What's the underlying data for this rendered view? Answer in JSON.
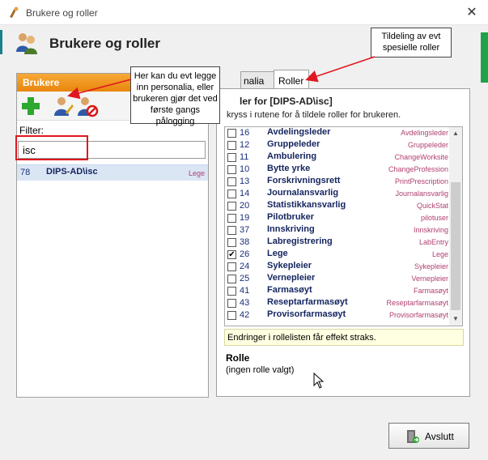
{
  "window": {
    "title": "Brukere og roller",
    "close_glyph": "✕"
  },
  "header": {
    "title": "Brukere og roller",
    "icon": "users-icon"
  },
  "left_panel": {
    "section_title": "Brukere",
    "filter_label": "Filter:",
    "filter_value": "isc",
    "users": [
      {
        "id": "78",
        "name": "DIPS-AD\\isc",
        "role": "Lege"
      }
    ]
  },
  "right_panel": {
    "tabs": [
      {
        "label": "nalia",
        "active": false
      },
      {
        "label": "Roller",
        "active": true
      }
    ],
    "heading": "ler for [DIPS-AD\\isc]",
    "subheading": "kryss i rutene for å tildele roller for brukeren.",
    "roles": [
      {
        "id": "16",
        "name": "Avdelingsleder",
        "code": "Avdelingsleder",
        "checked": false
      },
      {
        "id": "12",
        "name": "Gruppeleder",
        "code": "Gruppeleder",
        "checked": false
      },
      {
        "id": "11",
        "name": "Ambulering",
        "code": "ChangeWorksite",
        "checked": false
      },
      {
        "id": "10",
        "name": "Bytte yrke",
        "code": "ChangeProfession",
        "checked": false
      },
      {
        "id": "13",
        "name": "Forskrivningsrett",
        "code": "PrintPrescription",
        "checked": false
      },
      {
        "id": "14",
        "name": "Journalansvarlig",
        "code": "Journalansvarlig",
        "checked": false
      },
      {
        "id": "20",
        "name": "Statistikkansvarlig",
        "code": "QuickStat",
        "checked": false
      },
      {
        "id": "19",
        "name": "Pilotbruker",
        "code": "pilotuser",
        "checked": false
      },
      {
        "id": "37",
        "name": "Innskriving",
        "code": "Innskriving",
        "checked": false
      },
      {
        "id": "38",
        "name": "Labregistrering",
        "code": "LabEntry",
        "checked": false
      },
      {
        "id": "26",
        "name": "Lege",
        "code": "Lege",
        "checked": true
      },
      {
        "id": "24",
        "name": "Sykepleier",
        "code": "Sykepleier",
        "checked": false
      },
      {
        "id": "25",
        "name": "Vernepleier",
        "code": "Vernepleier",
        "checked": false
      },
      {
        "id": "41",
        "name": "Farmasøyt",
        "code": "Farmasøyt",
        "checked": false
      },
      {
        "id": "43",
        "name": "Reseptarfarmasøyt",
        "code": "Reseptarfarmasøyt",
        "checked": false
      },
      {
        "id": "42",
        "name": "Provisorfarmasøyt",
        "code": "Provisorfarmasøyt",
        "checked": false
      }
    ],
    "info_text": "Endringer i rollelisten får effekt straks.",
    "rolle_title": "Rolle",
    "rolle_value": "(ingen rolle valgt)"
  },
  "footer": {
    "exit_label": "Avslutt"
  },
  "callouts": {
    "left": "Her kan du evt legge inn personalia, eller brukeren gjør det ved første gangs pålogging",
    "right": "Tildeling av evt spesielle roller"
  },
  "colors": {
    "accent_orange": "#f7a936",
    "highlight_red": "#e0171f",
    "role_code": "#b04070",
    "name_blue": "#14245e"
  }
}
